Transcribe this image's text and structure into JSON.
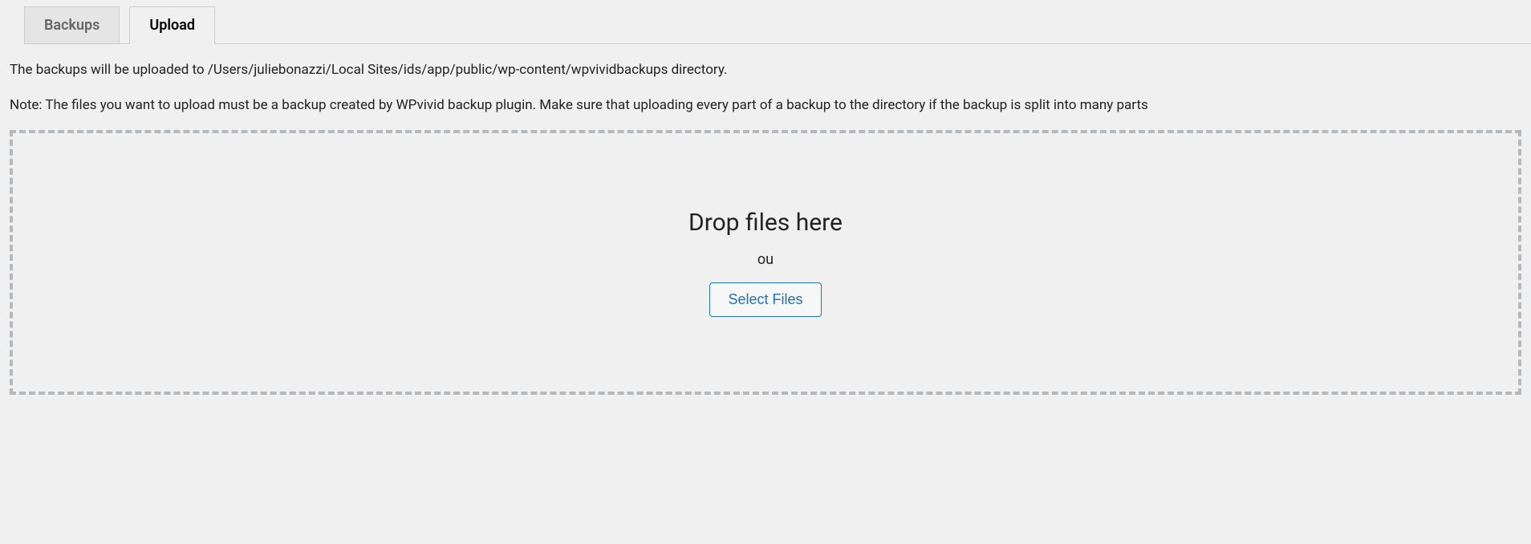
{
  "tabs": {
    "backups": "Backups",
    "upload": "Upload"
  },
  "content": {
    "info_path": "The backups will be uploaded to /Users/juliebonazzi/Local Sites/ids/app/public/wp-content/wpvividbackups directory.",
    "info_note": "Note: The files you want to upload must be a backup created by WPvivid backup plugin. Make sure that uploading every part of a backup to the directory if the backup is split into many parts"
  },
  "dropzone": {
    "title": "Drop files here",
    "or": "ou",
    "button": "Select Files"
  }
}
